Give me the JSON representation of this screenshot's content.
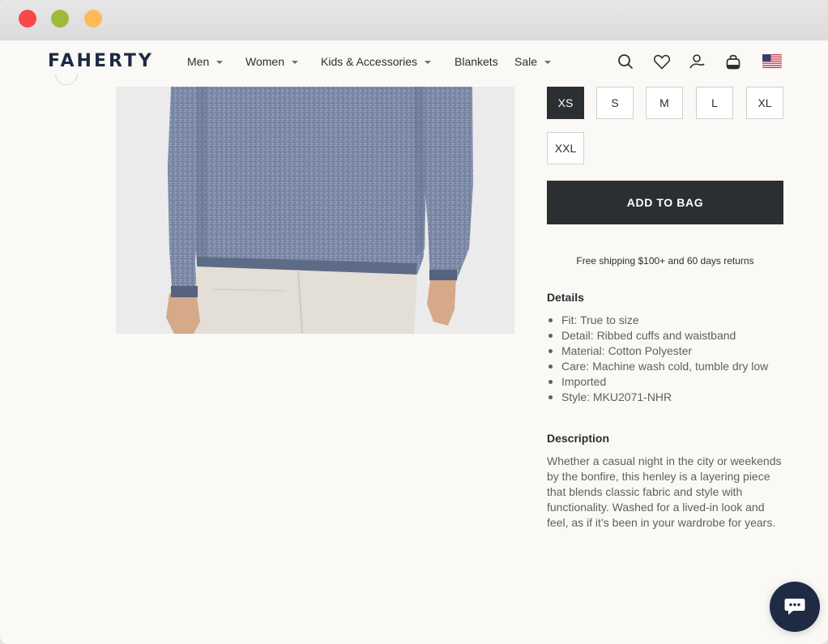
{
  "header": {
    "logo": "FAHERTY",
    "nav": [
      {
        "label": "Men",
        "has_dropdown": true
      },
      {
        "label": "Women",
        "has_dropdown": true
      },
      {
        "label": "Kids & Accessories",
        "has_dropdown": true
      },
      {
        "label": "Blankets",
        "has_dropdown": false
      },
      {
        "label": "Sale",
        "has_dropdown": true
      }
    ],
    "icons": [
      "search-icon",
      "heart-icon",
      "account-icon",
      "bag-icon",
      "us-flag-icon"
    ]
  },
  "product": {
    "sizes": [
      {
        "label": "XS",
        "selected": true
      },
      {
        "label": "S",
        "selected": false
      },
      {
        "label": "M",
        "selected": false
      },
      {
        "label": "L",
        "selected": false
      },
      {
        "label": "XL",
        "selected": false
      },
      {
        "label": "XXL",
        "selected": false
      }
    ],
    "add_to_bag_label": "ADD TO BAG",
    "shipping_note": "Free shipping $100+ and 60 days returns",
    "details_title": "Details",
    "details": [
      "Fit: True to size",
      "Detail: Ribbed cuffs and waistband",
      "Material: Cotton Polyester",
      "Care: Machine wash cold, tumble dry low",
      "Imported",
      "Style: MKU2071-NHR"
    ],
    "description_title": "Description",
    "description": "Whether a casual night in the city or weekends by the bonfire, this henley is a layering piece that blends classic fabric and style with functionality. Washed for a lived-in look and feel, as if it’s been in your wardrobe for years."
  },
  "chat": {
    "icon": "chat-bubble-icon"
  },
  "colors": {
    "brand_navy": "#1f2a44",
    "button_dark": "#2b2f31",
    "page_bg": "#faf9f6"
  }
}
